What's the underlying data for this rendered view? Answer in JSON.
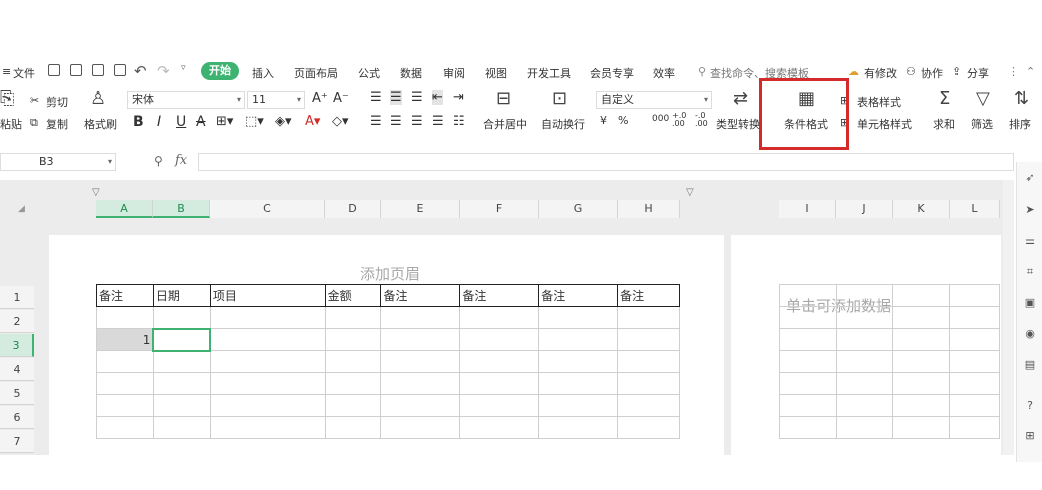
{
  "menu": {
    "hamburger": "≡",
    "file": "文件",
    "tabs": [
      "开始",
      "插入",
      "页面布局",
      "公式",
      "数据",
      "审阅",
      "视图",
      "开发工具",
      "会员专享",
      "效率"
    ],
    "search": "查找命令、搜索模板",
    "has_changes": "有修改",
    "collab": "协作",
    "share": "分享"
  },
  "toolbar": {
    "paste": "粘贴",
    "cut": "剪切",
    "copy": "复制",
    "format_painter": "格式刷",
    "font_name": "宋体",
    "font_size": "11",
    "font_grow": "A⁺",
    "font_shrink": "A⁻",
    "bold": "B",
    "italic": "I",
    "underline": "U",
    "strike": "A",
    "merge_center": "合并居中",
    "wrap_text": "自动换行",
    "number_format": "自定义",
    "currency": "¥",
    "percent": "%",
    "thousands": "000",
    "inc_decimal": "+.0\n.00",
    "dec_decimal": "-.0\n.00",
    "type_convert": "类型转换",
    "cond_format": "条件格式",
    "table_style": "表格样式",
    "cell_style": "单元格样式",
    "sum": "求和",
    "filter": "筛选",
    "sort": "排序"
  },
  "formula_bar": {
    "name_box": "B3",
    "fx": "fx"
  },
  "sheet": {
    "columns": [
      "A",
      "B",
      "C",
      "D",
      "E",
      "F",
      "G",
      "H"
    ],
    "columns_page2": [
      "I",
      "J",
      "K",
      "L"
    ],
    "rows": [
      "1",
      "2",
      "3",
      "4",
      "5",
      "6",
      "7"
    ],
    "header_placeholder": "添加页眉",
    "page2_placeholder": "单击可添加数据",
    "header_row": [
      "备注",
      "日期",
      "项目",
      "金额",
      "备注",
      "备注",
      "备注",
      "备注"
    ],
    "cell_a3": "1"
  }
}
